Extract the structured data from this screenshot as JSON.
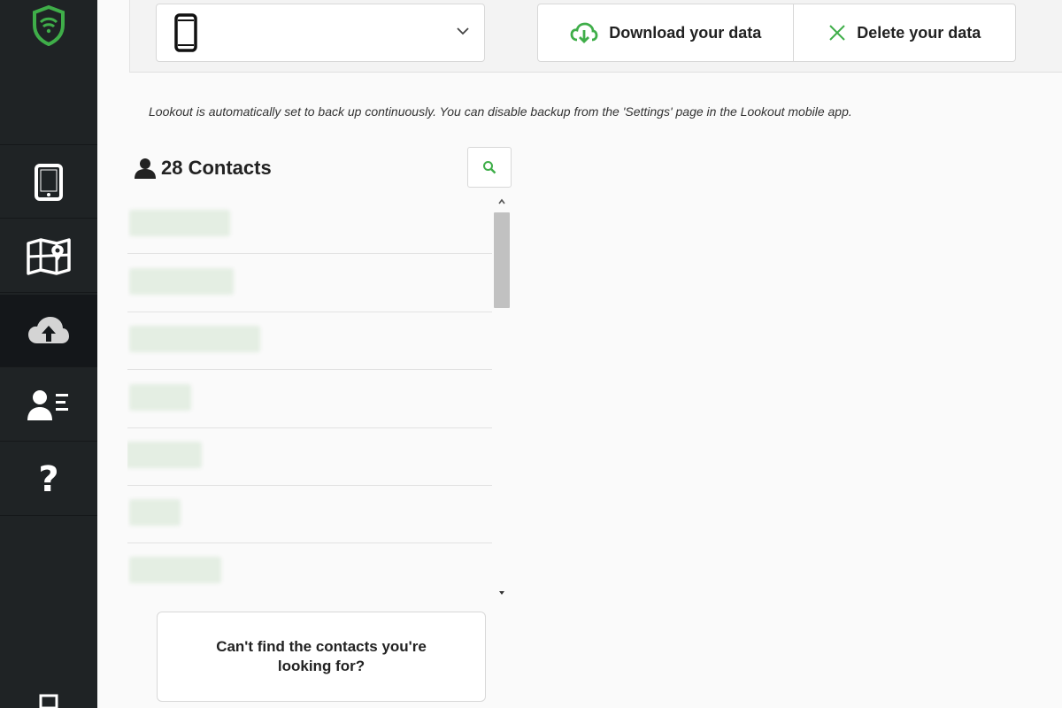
{
  "sidebar": {
    "items": [
      {
        "name": "shield-logo-icon"
      },
      {
        "name": "tablet-icon"
      },
      {
        "name": "map-location-icon"
      },
      {
        "name": "cloud-upload-icon",
        "active": true
      },
      {
        "name": "contacts-card-icon"
      },
      {
        "name": "help-question-icon",
        "label": "?"
      }
    ]
  },
  "topbar": {
    "device_icon": "phone-icon",
    "download_label": "Download your data",
    "delete_label": "Delete your data"
  },
  "info_text": "Lookout is automatically set to back up continuously. You can disable backup from the 'Settings' page in the Lookout mobile app.",
  "contacts": {
    "title": "28 Contacts",
    "count": 28,
    "search_icon": "search-icon"
  },
  "help_box": {
    "label": "Can't find the contacts you're looking for?"
  },
  "colors": {
    "sidebar_bg": "#1f2325",
    "accent_green": "#3fae49",
    "page_bg": "#fafafa"
  }
}
